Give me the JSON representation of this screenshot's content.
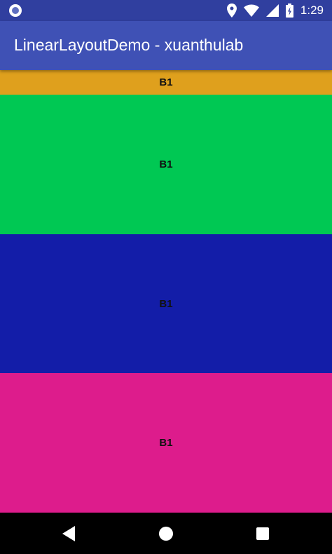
{
  "status_bar": {
    "time": "1:29",
    "icons": [
      "app-notification-icon",
      "location-icon",
      "wifi-icon",
      "signal-icon",
      "battery-charging-icon"
    ]
  },
  "app_bar": {
    "title": "LinearLayoutDemo - xuanthulab"
  },
  "blocks": [
    {
      "label": "B1",
      "color": "#DFA01D"
    },
    {
      "label": "B1",
      "color": "#00C853"
    },
    {
      "label": "B1",
      "color": "#131DA8"
    },
    {
      "label": "B1",
      "color": "#DD1C8C"
    }
  ],
  "navigation": {
    "icons": [
      "back-icon",
      "home-icon",
      "recents-icon"
    ]
  },
  "colors": {
    "status_bar": "#303F9F",
    "app_bar": "#3F51B5",
    "nav_bar": "#000000"
  }
}
